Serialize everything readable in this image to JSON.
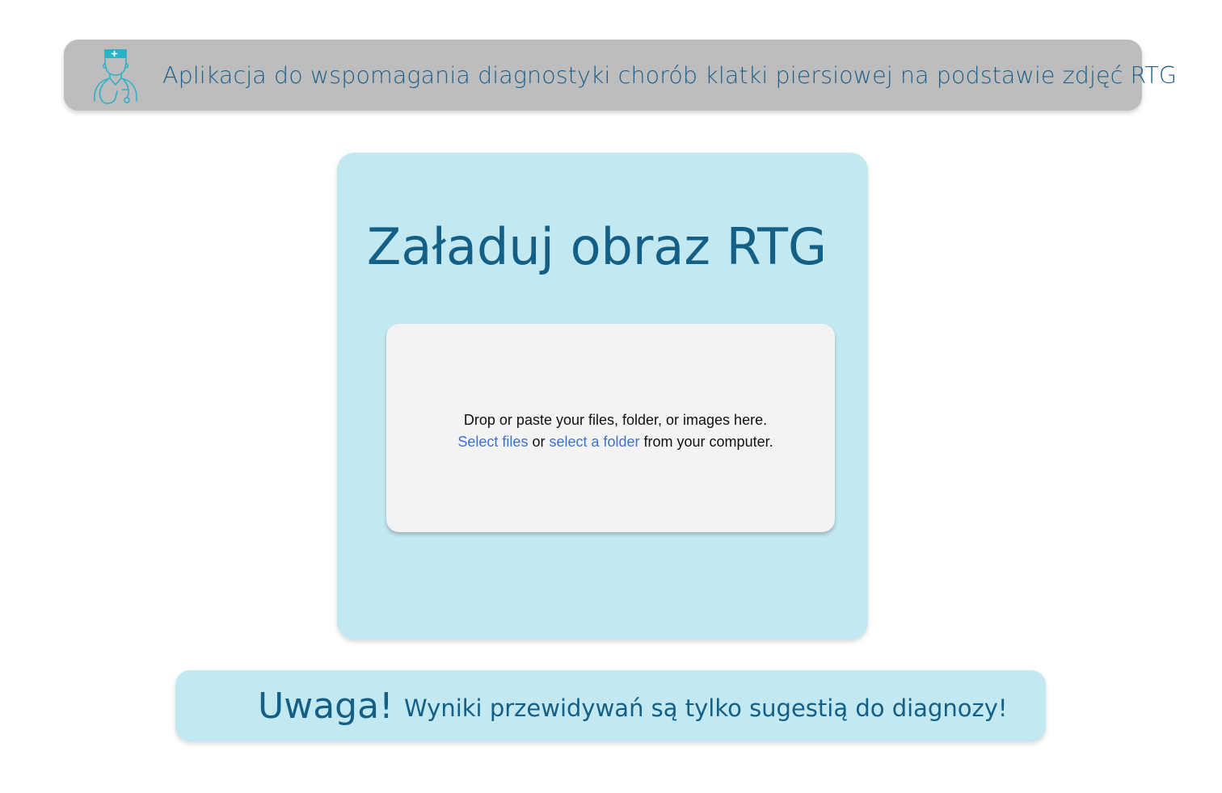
{
  "header": {
    "title": "Aplikacja do wspomagania diagnostyki chorób klatki piersiowej na podstawie zdjęć RTG",
    "logo_icon": "doctor-stethoscope-icon"
  },
  "upload": {
    "title": "Załaduj obraz RTG",
    "dropzone": {
      "line1": "Drop or paste your files, folder, or images here.",
      "select_files_label": "Select files",
      "or_text": " or ",
      "select_folder_label": "select a folder",
      "from_text": " from your computer."
    }
  },
  "warning": {
    "title": "Uwaga!",
    "text": "Wyniki przewidywań są tylko sugestią do diagnozy!"
  },
  "colors": {
    "header_bg": "#bdbdbd",
    "card_bg": "#c2e8f1",
    "dropzone_bg": "#f3f3f3",
    "text_primary": "#145f86",
    "link": "#3d72d1",
    "logo_accent": "#2bb2c9"
  }
}
